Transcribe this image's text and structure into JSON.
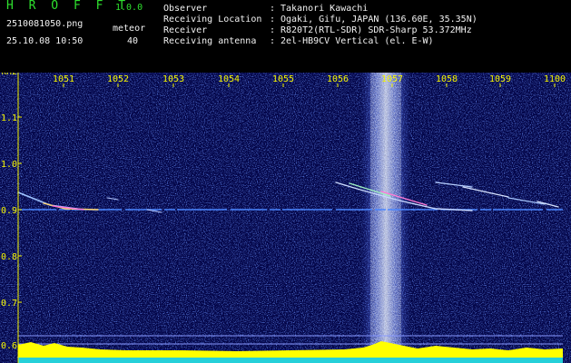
{
  "app": {
    "name": "H R O F F T",
    "version": "1.0.0"
  },
  "file": {
    "name": "2510081050.png",
    "datetime": "25.10.08 10:50"
  },
  "meteor": {
    "label": "meteor",
    "count": "40"
  },
  "info": [
    {
      "key": "Observer",
      "value": "Takanori Kawachi"
    },
    {
      "key": "Receiving Location",
      "value": "Ogaki, Gifu, JAPAN (136.60E, 35.35N)"
    },
    {
      "key": "Receiver",
      "value": "R820T2(RTL-SDR) SDR-Sharp 53.372MHz"
    },
    {
      "key": "Receiving antenna",
      "value": "2el-HB9CV Vertical (el. E-W)"
    }
  ],
  "info_separator": ":",
  "axis": {
    "y_unit": "kHz",
    "y_ticks": [
      "1.1",
      "1.0",
      "0.9",
      "0.8",
      "0.7",
      "0.6"
    ],
    "x_ticks": [
      "1051",
      "1052",
      "1053",
      "1054",
      "1055",
      "1056",
      "1057",
      "1058",
      "1059",
      "1100"
    ]
  },
  "colors": {
    "background": "#000000",
    "plot_background": "#020440",
    "text_green": "#35e035",
    "text_white": "#f2f2f2",
    "tick_yellow": "#f4f400",
    "noise_band": "#c8d8ff",
    "level_bar": "#ffff00",
    "level_bar_base": "#00c8ff"
  }
}
